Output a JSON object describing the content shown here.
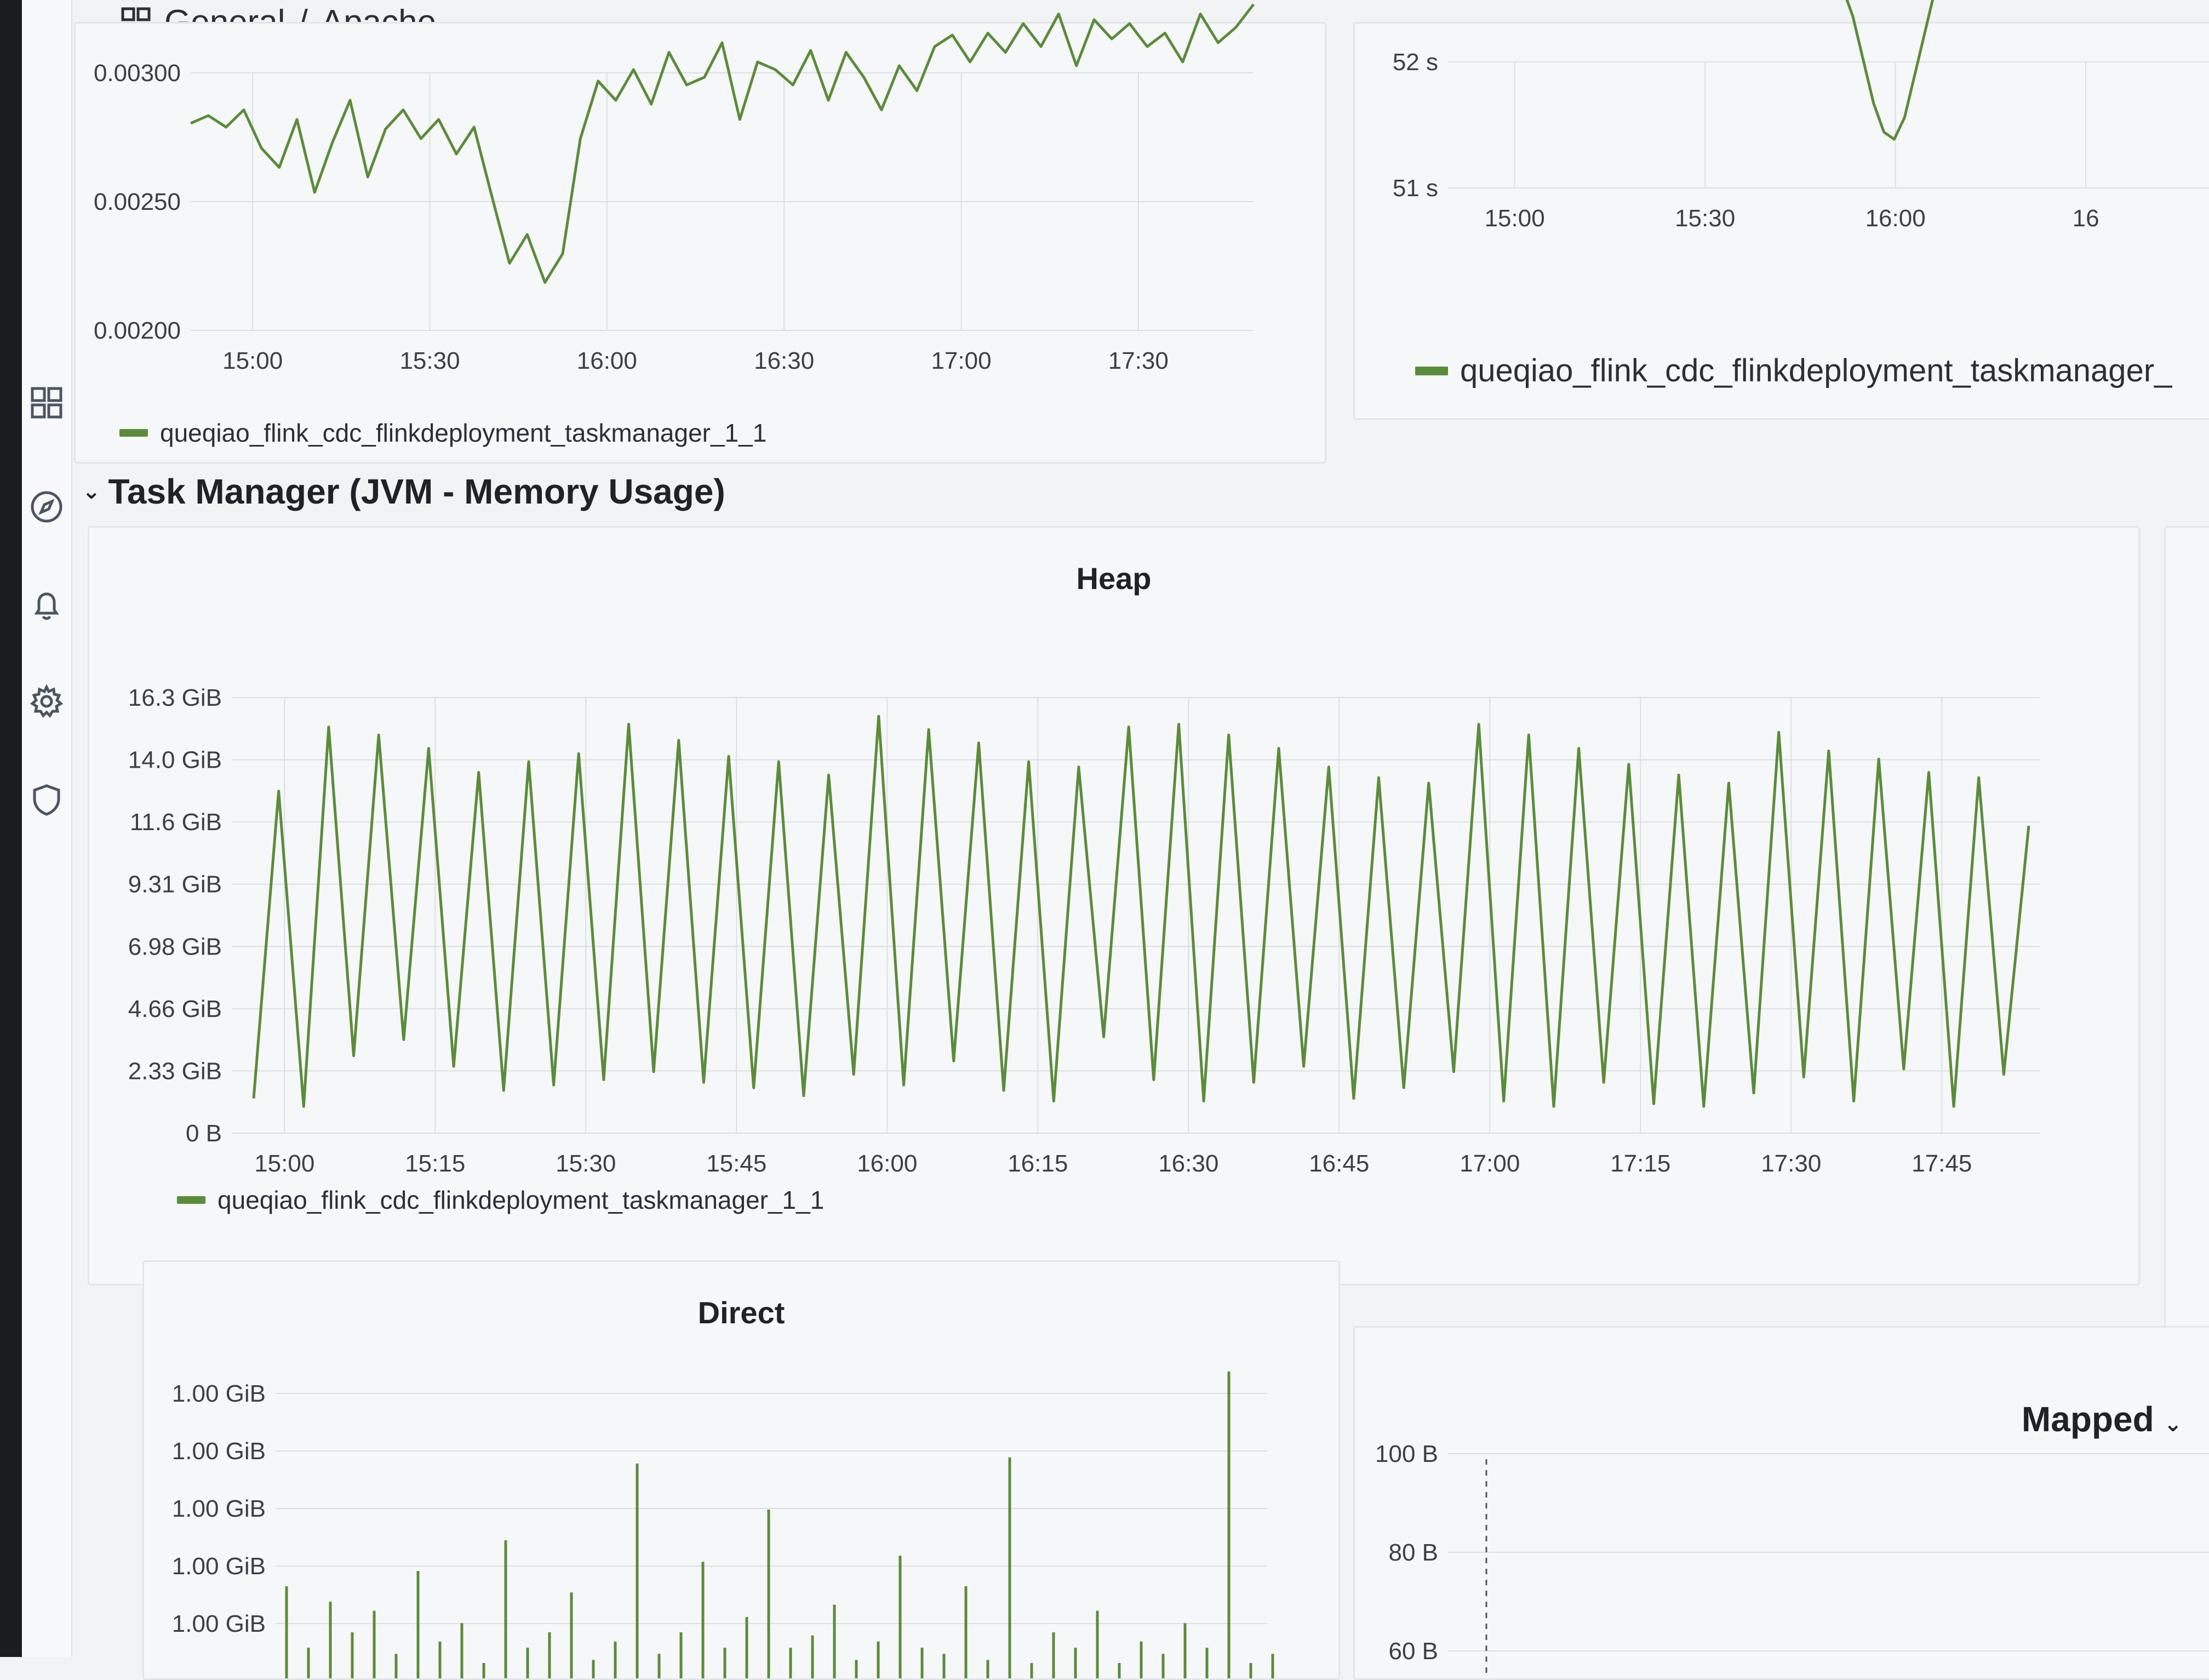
{
  "breadcrumb": {
    "parent": "General",
    "separator": "/",
    "current": "Apache"
  },
  "nav_icons": [
    "dashboards-icon",
    "explore-icon",
    "alerting-bell-icon",
    "settings-gear-icon",
    "shield-icon"
  ],
  "row": {
    "title": "Task Manager (JVM - Memory Usage)"
  },
  "colors": {
    "series": "#5b8c3a",
    "grid": "#dcdfe3"
  },
  "panels": {
    "top_left": {
      "title": "",
      "legend": "queqiao_flink_cdc_flinkdeployment_taskmanager_1_1",
      "chart_data": {
        "type": "line",
        "y_ticks": [
          "0.00300",
          "0.00250",
          "0.00200"
        ],
        "x_ticks": [
          "15:00",
          "15:30",
          "16:00",
          "16:30",
          "17:00",
          "17:30"
        ],
        "ylim": [
          0.0019,
          0.0035
        ],
        "series": [
          {
            "name": "queqiao_flink_cdc_flinkdeployment_taskmanager_1_1",
            "values": [
              0.00298,
              0.00302,
              0.00296,
              0.00305,
              0.00285,
              0.00275,
              0.003,
              0.00262,
              0.00288,
              0.0031,
              0.0027,
              0.00295,
              0.00305,
              0.0029,
              0.003,
              0.00282,
              0.00296,
              0.0026,
              0.00225,
              0.0024,
              0.00215,
              0.0023,
              0.0029,
              0.0032,
              0.0031,
              0.00326,
              0.00308,
              0.00335,
              0.00318,
              0.00322,
              0.0034,
              0.003,
              0.0033,
              0.00326,
              0.00318,
              0.00336,
              0.0031,
              0.00335,
              0.00322,
              0.00305,
              0.00328,
              0.00315,
              0.00338,
              0.00344,
              0.0033,
              0.00345,
              0.00335,
              0.0035,
              0.00338,
              0.00355,
              0.00328,
              0.00352,
              0.00342,
              0.0035,
              0.00338,
              0.00345,
              0.0033,
              0.00355,
              0.0034,
              0.00348,
              0.0036
            ]
          }
        ]
      }
    },
    "top_right": {
      "title": "",
      "legend": "queqiao_flink_cdc_flinkdeployment_taskmanager_",
      "chart_data": {
        "type": "line",
        "y_ticks": [
          "52 s",
          "51 s"
        ],
        "x_ticks": [
          "15:00",
          "15:30",
          "16:00",
          "16"
        ],
        "ylim": [
          50.0,
          52.5
        ],
        "series": [
          {
            "name": "queqiao_flink_cdc_flinkdeployment_taskmanager_",
            "values": [
              53.0,
              52.6,
              52.0,
              51.4,
              51.0,
              50.9,
              51.2,
              51.8,
              52.4,
              53.0
            ]
          }
        ]
      }
    },
    "heap": {
      "title": "Heap",
      "legend": "queqiao_flink_cdc_flinkdeployment_taskmanager_1_1",
      "chart_data": {
        "type": "line",
        "y_ticks": [
          "16.3 GiB",
          "14.0 GiB",
          "11.6 GiB",
          "9.31 GiB",
          "6.98 GiB",
          "4.66 GiB",
          "2.33 GiB",
          "0 B"
        ],
        "y_values": [
          16.3,
          14.0,
          11.6,
          9.31,
          6.98,
          4.66,
          2.33,
          0
        ],
        "x_ticks": [
          "15:00",
          "15:15",
          "15:30",
          "15:45",
          "16:00",
          "16:15",
          "16:30",
          "16:45",
          "17:00",
          "17:15",
          "17:30",
          "17:45"
        ],
        "ylim": [
          0,
          16.3
        ],
        "series": [
          {
            "name": "queqiao_flink_cdc_flinkdeployment_taskmanager_1_1",
            "peaks": [
              12.8,
              15.2,
              14.9,
              14.4,
              13.5,
              13.9,
              14.2,
              15.3,
              14.7,
              14.1,
              13.9,
              13.4,
              15.6,
              15.1,
              14.6,
              13.9,
              13.7,
              15.2,
              15.3,
              14.9,
              14.4,
              13.7,
              13.3,
              13.1,
              15.3,
              14.9,
              14.4,
              13.8,
              13.4,
              13.1,
              15.0,
              14.3,
              14.0,
              13.5,
              13.3,
              11.5
            ],
            "troughs": [
              1.3,
              1.0,
              2.9,
              3.5,
              2.5,
              1.6,
              1.8,
              2.0,
              2.3,
              1.9,
              1.7,
              1.4,
              2.2,
              1.8,
              2.7,
              1.6,
              1.2,
              3.6,
              2.0,
              1.2,
              1.9,
              2.5,
              1.3,
              1.7,
              2.3,
              1.2,
              1.0,
              1.9,
              1.1,
              1.0,
              1.5,
              2.1,
              1.2,
              2.4,
              1.0,
              2.2
            ]
          }
        ]
      }
    },
    "direct": {
      "title": "Direct",
      "chart_data": {
        "type": "line",
        "y_ticks": [
          "1.00 GiB",
          "1.00 GiB",
          "1.00 GiB",
          "1.00 GiB",
          "1.00 GiB"
        ],
        "ylim": [
          0,
          1
        ],
        "series": [
          {
            "name": "",
            "values": [
              0.3,
              0.1,
              0.25,
              0.15,
              0.22,
              0.08,
              0.35,
              0.12,
              0.18,
              0.05,
              0.45,
              0.1,
              0.15,
              0.28,
              0.06,
              0.12,
              0.7,
              0.08,
              0.15,
              0.38,
              0.1,
              0.2,
              0.55,
              0.1,
              0.14,
              0.24,
              0.06,
              0.12,
              0.4,
              0.1,
              0.08,
              0.3,
              0.06,
              0.72,
              0.05,
              0.15,
              0.1,
              0.22,
              0.05,
              0.12,
              0.08,
              0.18,
              0.1,
              1.0,
              0.05,
              0.08
            ]
          }
        ]
      }
    },
    "mapped": {
      "title": "Mapped",
      "chart_data": {
        "type": "line",
        "y_ticks": [
          "100 B",
          "80 B",
          "60 B"
        ],
        "ylim": [
          50,
          110
        ],
        "series": []
      }
    }
  }
}
